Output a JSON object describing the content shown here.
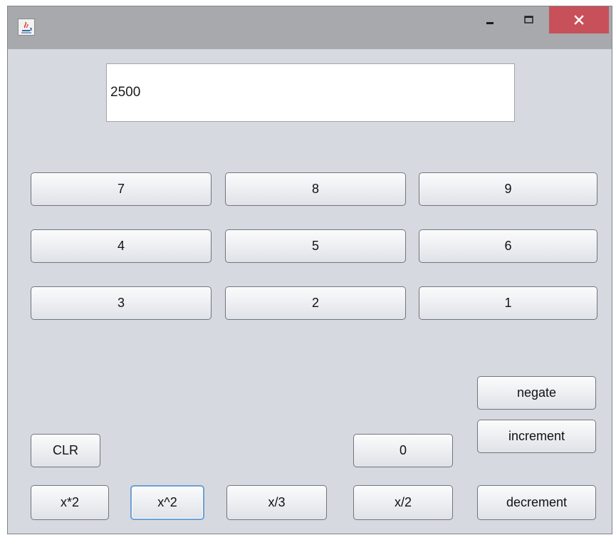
{
  "window": {
    "controls": {
      "minimize": "minimize-icon",
      "maximize": "maximize-icon",
      "close": "close-icon"
    },
    "colors": {
      "close_bg": "#c7505a",
      "titlebar_bg": "#a7a9ad",
      "body_bg": "#d6d9df"
    }
  },
  "display": {
    "value": "2500"
  },
  "keypad": {
    "row1": [
      "7",
      "8",
      "9"
    ],
    "row2": [
      "4",
      "5",
      "6"
    ],
    "row3": [
      "3",
      "2",
      "1"
    ]
  },
  "actions": {
    "negate": "negate",
    "increment": "increment",
    "clear": "CLR",
    "zero": "0",
    "times_two": "x*2",
    "square": "x^2",
    "divide_three": "x/3",
    "divide_two": "x/2",
    "decrement": "decrement"
  }
}
